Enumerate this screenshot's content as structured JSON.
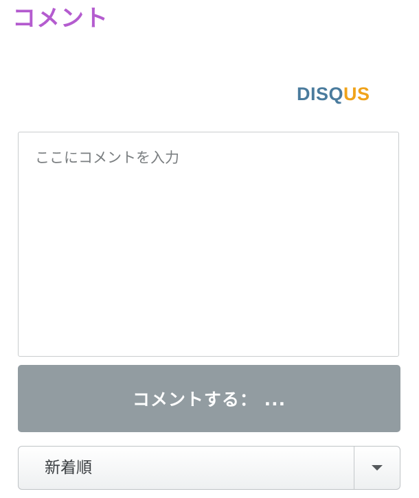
{
  "section": {
    "title": "コメント",
    "title_color": "#b45ccf"
  },
  "brand": {
    "part1": "DISQ",
    "part2": "US",
    "color_primary": "#4a7b9d",
    "color_accent": "#f0a31b"
  },
  "comment": {
    "placeholder": "ここにコメントを入力"
  },
  "submit": {
    "label": "コメントする： ..."
  },
  "sort": {
    "selected": "新着順",
    "icon": "caret-down-icon"
  }
}
